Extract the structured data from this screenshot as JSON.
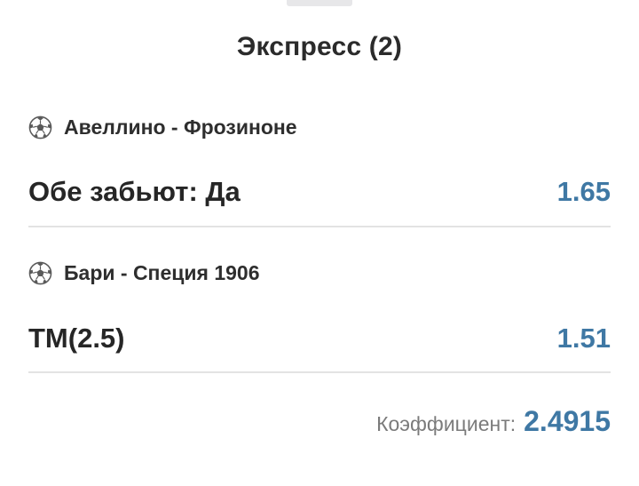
{
  "sheet": {
    "title": "Экспресс (2)"
  },
  "events": [
    {
      "match": "Авеллино - Фрозиноне",
      "sport_icon": "soccer-ball-icon",
      "bet": "Обе забьют: Да",
      "odd": "1.65"
    },
    {
      "match": "Бари - Специя 1906",
      "sport_icon": "soccer-ball-icon",
      "bet": "ТМ(2.5)",
      "odd": "1.51"
    }
  ],
  "summary": {
    "coefficient_label": "Коэффициент:",
    "coefficient_value": "2.4915"
  },
  "colors": {
    "accent": "#3f78a4",
    "text": "#262626",
    "muted": "#7b7b7b",
    "divider": "#e3e3e3"
  }
}
